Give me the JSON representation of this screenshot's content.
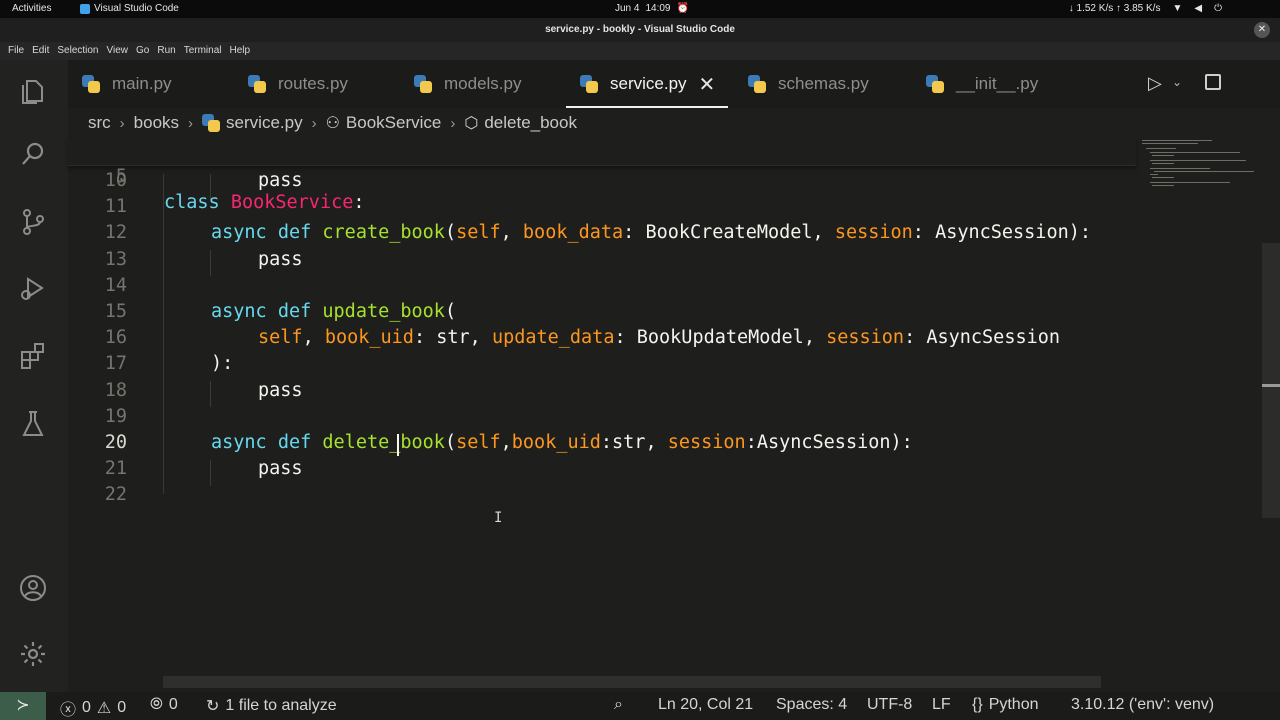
{
  "os_bar": {
    "activities": "Activities",
    "app_name": "Visual Studio Code",
    "date": "Jun 4",
    "time": "14:09",
    "net_speed": "↓ 1.52 K/s ↑ 3.85 K/s"
  },
  "window": {
    "title": "service.py - bookly - Visual Studio Code"
  },
  "menu": [
    "File",
    "Edit",
    "Selection",
    "View",
    "Go",
    "Run",
    "Terminal",
    "Help"
  ],
  "tabs": [
    {
      "label": "main.py",
      "active": false
    },
    {
      "label": "routes.py",
      "active": false
    },
    {
      "label": "models.py",
      "active": false
    },
    {
      "label": "service.py",
      "active": true
    },
    {
      "label": "schemas.py",
      "active": false
    },
    {
      "label": "__init__.py",
      "active": false
    }
  ],
  "breadcrumb": [
    "src",
    "books",
    "service.py",
    "BookService",
    "delete_book"
  ],
  "editor": {
    "sticky_line": {
      "num": "5",
      "text": "class BookService:"
    },
    "lines": [
      {
        "num": "10",
        "text": "pass"
      },
      {
        "num": "11",
        "text": ""
      },
      {
        "num": "12",
        "text": "async def create_book(self, book_data: BookCreateModel, session: AsyncSession):"
      },
      {
        "num": "13",
        "text": "pass"
      },
      {
        "num": "14",
        "text": ""
      },
      {
        "num": "15",
        "text": "async def update_book("
      },
      {
        "num": "16",
        "text": "self, book_uid: str, update_data: BookUpdateModel, session: AsyncSession"
      },
      {
        "num": "17",
        "text": "):"
      },
      {
        "num": "18",
        "text": "pass"
      },
      {
        "num": "19",
        "text": ""
      },
      {
        "num": "20",
        "text": "async def delete_book(self,book_uid:str, session:AsyncSession):"
      },
      {
        "num": "21",
        "text": "pass"
      },
      {
        "num": "22",
        "text": ""
      }
    ],
    "current_line": "20"
  },
  "status": {
    "errors": "0",
    "warnings": "0",
    "ports": "0",
    "analyze": "1 file to analyze",
    "position": "Ln 20, Col 21",
    "spaces": "Spaces: 4",
    "encoding": "UTF-8",
    "eol": "LF",
    "language": "Python",
    "interpreter": "3.10.12 ('env': venv)"
  },
  "colors": {
    "keyword": "#66d9ef",
    "function": "#a6e22e",
    "parameter": "#fd971f",
    "class": "#f92672",
    "status_remote": "#3b5d4a"
  }
}
